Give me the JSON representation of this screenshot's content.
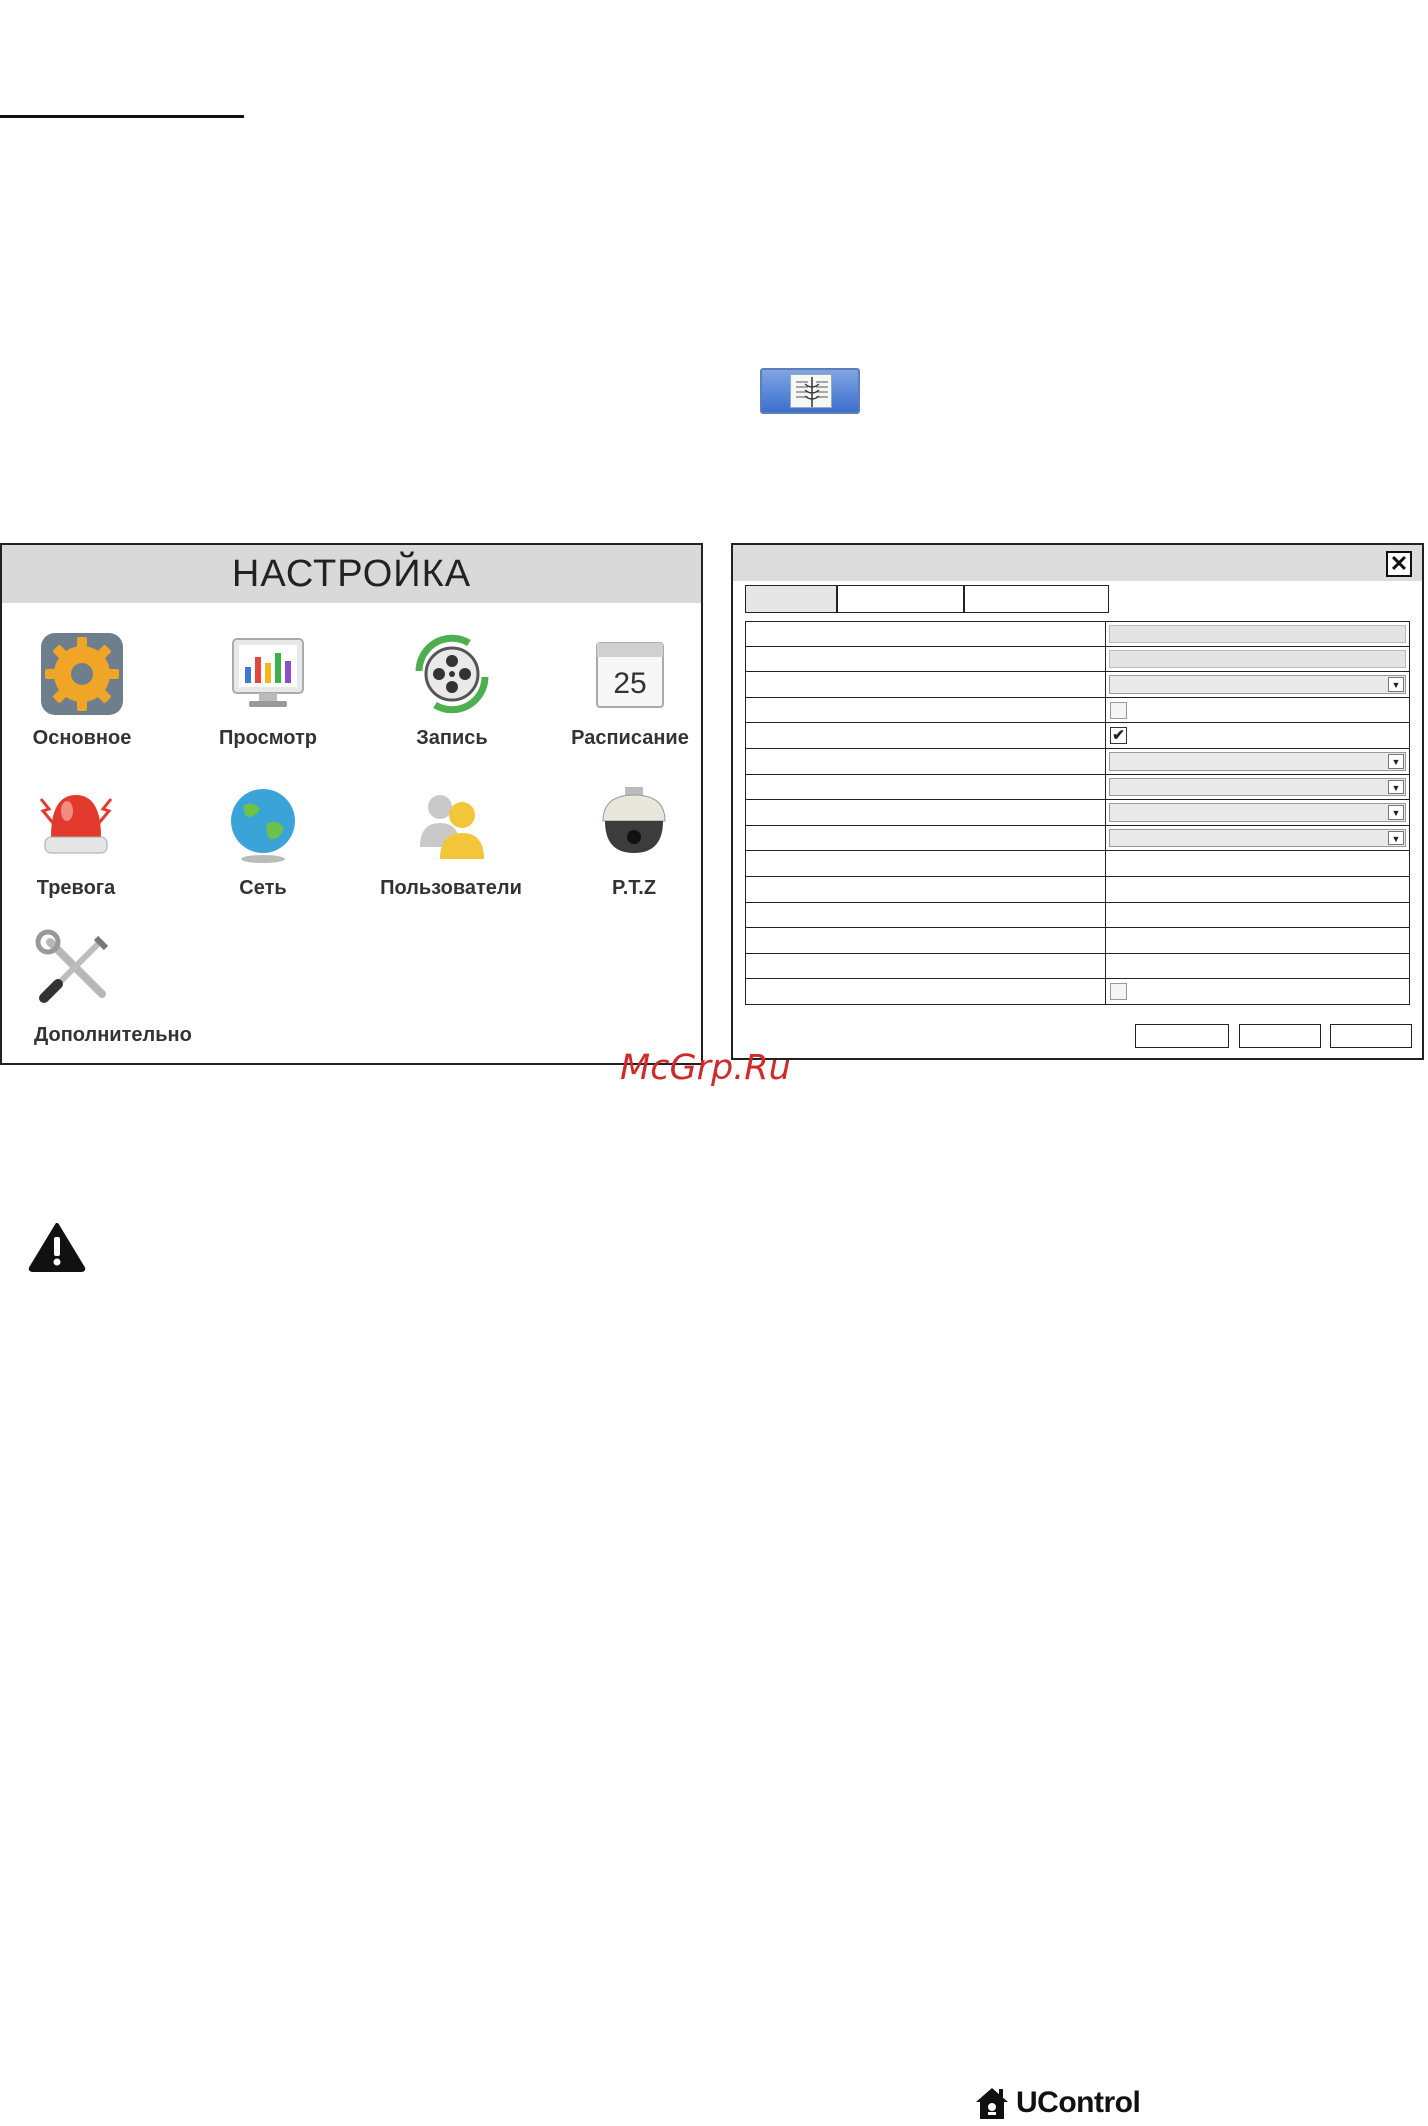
{
  "settings_menu": {
    "title": "НАСТРОЙКА",
    "items": [
      {
        "label": "Основное",
        "icon": "gear-icon"
      },
      {
        "label": "Просмотр",
        "icon": "monitor-chart-icon"
      },
      {
        "label": "Запись",
        "icon": "film-reel-icon"
      },
      {
        "label": "Расписание",
        "icon": "calendar-icon"
      },
      {
        "label": "Тревога",
        "icon": "siren-icon"
      },
      {
        "label": "Сеть",
        "icon": "globe-icon"
      },
      {
        "label": "Пользователи",
        "icon": "users-icon"
      },
      {
        "label": "P.T.Z",
        "icon": "dome-camera-icon"
      },
      {
        "label": "Дополнительно",
        "icon": "tools-icon"
      }
    ],
    "calendar_day": "25"
  },
  "dialog": {
    "close_label": "✕",
    "checkmark": "✔",
    "select_arrow": "▼"
  },
  "watermark": "McGrp.Ru",
  "brand": {
    "name": "UControl"
  }
}
